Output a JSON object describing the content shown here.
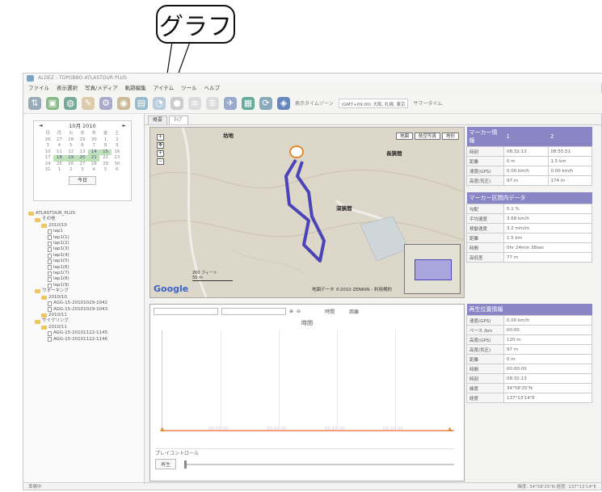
{
  "callout": {
    "label": "グラフ"
  },
  "window": {
    "title": "ALDEZ - TOPOBBO ATLASTOUR PLUS"
  },
  "menu": [
    "ファイル",
    "表示選択",
    "写真/メディア",
    "軌跡編集",
    "アイテム",
    "ツール",
    "ヘルプ"
  ],
  "toolbar": {
    "timezone_label": "表示タイムゾーン",
    "timezone_value": "(GMT+09:00) 大阪, 札幌, 東京",
    "summary_label": "サマータイム"
  },
  "calendar": {
    "month": "10月 2010",
    "weekdays": [
      "日",
      "月",
      "火",
      "水",
      "木",
      "金",
      "土"
    ],
    "days": [
      "26",
      "27",
      "28",
      "29",
      "30",
      "1",
      "2",
      "3",
      "4",
      "5",
      "6",
      "7",
      "8",
      "9",
      "10",
      "11",
      "12",
      "13",
      "14",
      "15",
      "16",
      "17",
      "18",
      "19",
      "20",
      "21",
      "22",
      "23",
      "24",
      "25",
      "26",
      "27",
      "28",
      "29",
      "30",
      "31",
      "1",
      "2",
      "3",
      "4",
      "5",
      "6"
    ],
    "highlight_days": [
      "14",
      "15",
      "18",
      "19",
      "20",
      "21"
    ],
    "today_label": "今日"
  },
  "tree": [
    {
      "level": 0,
      "kind": "root",
      "label": "ATLASTOUR_PLUS"
    },
    {
      "level": 1,
      "kind": "folder",
      "label": "その他"
    },
    {
      "level": 2,
      "kind": "folder",
      "label": "2010/10"
    },
    {
      "level": 3,
      "kind": "file",
      "label": "lap1"
    },
    {
      "level": 3,
      "kind": "file",
      "label": "lap1(1)"
    },
    {
      "level": 3,
      "kind": "file",
      "label": "lap1(2)"
    },
    {
      "level": 3,
      "kind": "file",
      "label": "lap1(3)"
    },
    {
      "level": 3,
      "kind": "file",
      "label": "lap1(4)"
    },
    {
      "level": 3,
      "kind": "file",
      "label": "lap1(5)"
    },
    {
      "level": 3,
      "kind": "file",
      "label": "lap1(6)"
    },
    {
      "level": 3,
      "kind": "file",
      "label": "lap1(7)"
    },
    {
      "level": 3,
      "kind": "file",
      "label": "lap1(8)"
    },
    {
      "level": 3,
      "kind": "file",
      "label": "lap1(9)"
    },
    {
      "level": 1,
      "kind": "folder",
      "label": "ウォーキング"
    },
    {
      "level": 2,
      "kind": "folder",
      "label": "2010/10"
    },
    {
      "level": 3,
      "kind": "file",
      "label": "AGG-15-20101029-1042"
    },
    {
      "level": 3,
      "kind": "file",
      "label": "AGG-15-20101029-1043"
    },
    {
      "level": 2,
      "kind": "folder",
      "label": "2010/11"
    },
    {
      "level": 1,
      "kind": "folder",
      "label": "サイクリング"
    },
    {
      "level": 2,
      "kind": "folder",
      "label": "2010/11"
    },
    {
      "level": 3,
      "kind": "file",
      "label": "AGG-15-20101122-1145"
    },
    {
      "level": 3,
      "kind": "file",
      "label": "AGG-15-20101122-1146"
    }
  ],
  "tabs": [
    "概要",
    "ﾏｯﾌﾟ"
  ],
  "map": {
    "type_buttons": [
      "地図",
      "航空写真",
      "地形"
    ],
    "labels": {
      "a": "坊地",
      "b": "長狭間",
      "c": "深狭間"
    },
    "scale_top": "200 フィート",
    "scale_bottom": "50 m",
    "google": "Google",
    "copyright": "地図データ ©2010 ZENRIN - 利用規約"
  },
  "marker_info": {
    "title": "マーカー情報",
    "col1": "1",
    "col2": "2",
    "rows": [
      {
        "k": "時刻",
        "v1": "08:32:13",
        "v2": "08:55:51"
      },
      {
        "k": "距離",
        "v1": "0 m",
        "v2": "1.5 km"
      },
      {
        "k": "速度(GPS)",
        "v1": "0.00 km/h",
        "v2": "0.00 km/h"
      },
      {
        "k": "高度(気圧)",
        "v1": "97 m",
        "v2": "174 m"
      }
    ]
  },
  "marker_range": {
    "title": "マーカー区間内データ",
    "rows": [
      {
        "k": "勾配",
        "v": "5.1 %"
      },
      {
        "k": "平均速度",
        "v": "3.68 km/h"
      },
      {
        "k": "移動速度",
        "v": "3.2 min/m"
      },
      {
        "k": "距離",
        "v": "1.5 km"
      },
      {
        "k": "時間",
        "v": "0hr 24min 38sec"
      },
      {
        "k": "高低差",
        "v": "77 m"
      }
    ]
  },
  "playback_info": {
    "title": "再生位置情報",
    "rows": [
      {
        "k": "速度(GPS)",
        "v": "0.00 km/h"
      },
      {
        "k": "ペース /km",
        "v": "00:00"
      },
      {
        "k": "高度(GPS)",
        "v": "120 m"
      },
      {
        "k": "高度(気圧)",
        "v": "97 m"
      },
      {
        "k": "距離",
        "v": "0 m"
      },
      {
        "k": "時間",
        "v": "00:00:00"
      },
      {
        "k": "時刻",
        "v": "08:32:13"
      },
      {
        "k": "緯度",
        "v": "34°58'25\"N"
      },
      {
        "k": "経度",
        "v": "137°13'14\"E"
      }
    ]
  },
  "chart": {
    "title": "時間",
    "radio_time": "時間",
    "radio_distance": "距離",
    "ticks": [
      "00:05:00",
      "00:10:00",
      "00:15:00",
      "00:20:00"
    ],
    "play_group": "プレイコントロール",
    "play_button": "再生"
  },
  "chart_data": {
    "type": "line",
    "title": "時間",
    "x": [],
    "series": [],
    "xticks": [
      "00:05:00",
      "00:10:00",
      "00:15:00",
      "00:20:00"
    ]
  },
  "status": {
    "left": "準備中",
    "right": "緯度: 34°58'25\"N 経度: 137°13'14\"E"
  },
  "colors": {
    "track": "#4b44b8",
    "header": "#8a86c6",
    "axis": "#f2a07e",
    "calendar_hl": "#bfe0b8"
  }
}
